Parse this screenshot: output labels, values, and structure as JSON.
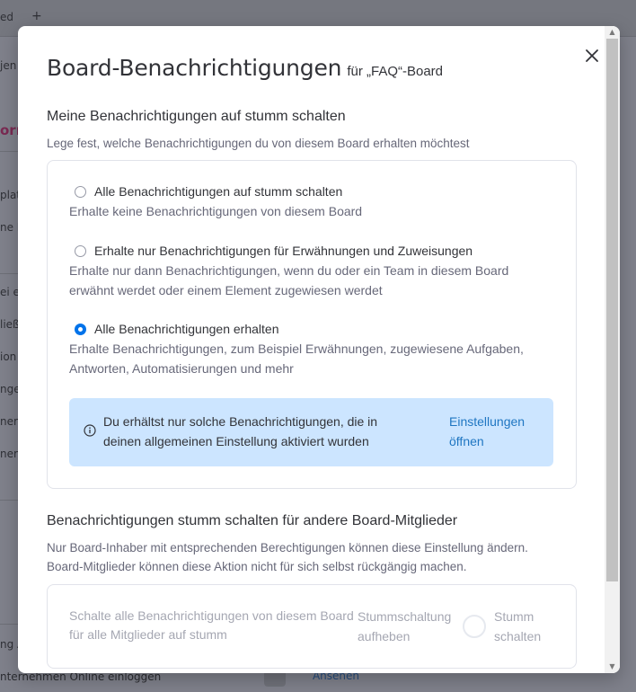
{
  "background": {
    "tab_fragment": "ed",
    "plus": "+",
    "side_fragments": [
      "jen",
      "orr",
      "plat",
      "ne P",
      "ei e",
      "ließ",
      "ion",
      "nge",
      "ner",
      "ner",
      "ng A"
    ],
    "bottom_text": "nternehmen Online einloggen",
    "bottom_button": "Ansehen"
  },
  "modal": {
    "title": "Board-Benachrichtigungen",
    "subtitle": "für „FAQ“-Board",
    "close_icon": "close-icon",
    "section1": {
      "heading": "Meine Benachrichtigungen auf stumm schalten",
      "description": "Lege fest, welche Benachrichtigungen du von diesem Board erhalten möchtest",
      "options": [
        {
          "label": "Alle Benachrichtigungen auf stumm schalten",
          "description": "Erhalte keine Benachrichtigungen von diesem Board",
          "selected": false
        },
        {
          "label": "Erhalte nur Benachrichtigungen für Erwähnungen und Zuweisungen",
          "description": "Erhalte nur dann Benachrichtigungen, wenn du oder ein Team in diesem Board erwähnt werdet oder einem Element zugewiesen werdet",
          "selected": false
        },
        {
          "label": "Alle Benachrichtigungen erhalten",
          "description": "Erhalte Benachrichtigungen, zum Beispiel Erwähnungen, zugewiesene Aufgaben, Antworten, Automatisierungen und mehr",
          "selected": true
        }
      ],
      "info": {
        "icon": "info-icon",
        "text": "Du erhältst nur solche Benachrichtigungen, die in deinen allgemeinen Einstellung aktiviert wurden",
        "link": "Einstellungen öffnen"
      }
    },
    "section2": {
      "heading": "Benachrichtigungen stumm schalten für andere Board-Mitglieder",
      "description": "Nur Board-Inhaber mit entsprechenden Berechtigungen können diese Einstellung ändern. Board-Mitglieder können diese Aktion nicht für sich selbst rückgängig machen.",
      "card_text": "Schalte alle Benachrichtigungen von diesem Board für alle Mitglieder auf stumm",
      "unmute_label": "Stummschaltung aufheben",
      "mute_label": "Stumm schalten",
      "toggle_on": false
    }
  },
  "colors": {
    "accent": "#0073ea",
    "info_bg": "#cce5ff",
    "link": "#1f76c2",
    "text_primary": "#323338",
    "text_secondary": "#676879"
  }
}
